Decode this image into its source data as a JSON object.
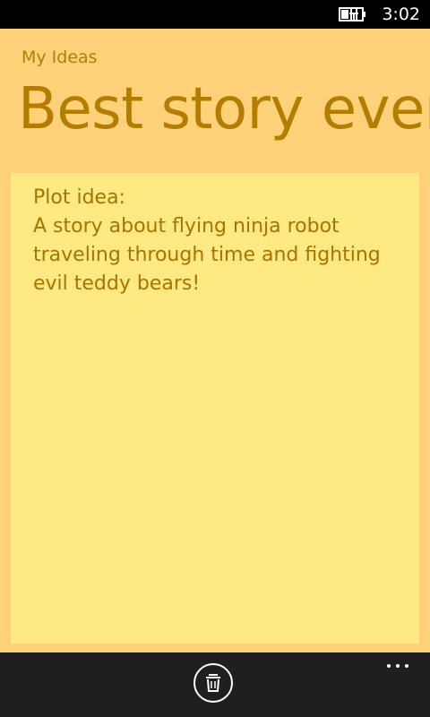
{
  "status_bar": {
    "time": "3:02",
    "battery_icon": "battery-charging-icon"
  },
  "app": {
    "app_title": "My Ideas",
    "page_title": "Best story ever",
    "background_color": "#ffd27a",
    "note_color": "#ffe982",
    "text_color": "#b37d00"
  },
  "note": {
    "lines": [
      "Plot idea:",
      "A story about flying ninja robot",
      "traveling through time and fighting",
      "evil teddy bears!"
    ]
  },
  "app_bar": {
    "delete_icon": "trash-icon",
    "more_icon": "ellipsis-icon"
  }
}
